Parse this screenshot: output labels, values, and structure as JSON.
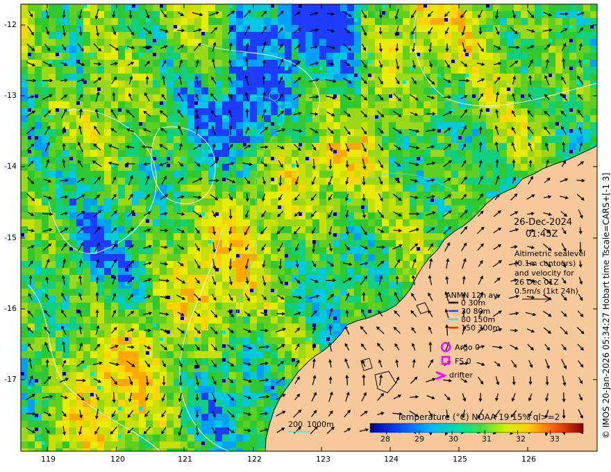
{
  "map": {
    "lat_ticks": [
      "-12",
      "-13",
      "-14",
      "-15",
      "-16",
      "-17"
    ],
    "lon_ticks": [
      "119",
      "120",
      "121",
      "122",
      "123",
      "124",
      "125",
      "126"
    ]
  },
  "annotation": {
    "date": "26-Dec-2024",
    "time": "01:45Z",
    "altimetry_lines": [
      "Altimetric sealevel",
      "(0.1m contours)",
      "and velocity for",
      "26 Dec 01Z",
      "0.5m/s (1kt 24h)"
    ]
  },
  "legend": {
    "title": "ANMN 12h av.",
    "items": [
      {
        "label": "0 30m",
        "color": "#000000"
      },
      {
        "label": "30 80m",
        "color": "#1a44ff"
      },
      {
        "label": "80 150m",
        "color": "#44dddd"
      },
      {
        "label": "150 300m",
        "color": "#ff2200"
      }
    ],
    "argo": "Argo 0",
    "fs": "FS 0",
    "drifter": "drifter",
    "marker_color": "#ff00ff"
  },
  "bathymetry_legend": {
    "label_200": "200",
    "label_1000": "1000m"
  },
  "colorbar": {
    "title": "Temperature (°C) NOAA 19 15% ql>=2",
    "ticks": [
      "28",
      "29",
      "30",
      "31",
      "32",
      "33"
    ],
    "range": [
      27.5,
      34
    ]
  },
  "credit": "© IMOS 20-Jan-2026 05:34:27 Hobart time Tscale=CARS+[-1 3]",
  "colors": {
    "land": "#f7c89a",
    "contour": "#e8f4ff",
    "contour_cyan": "#4ee0e0"
  }
}
